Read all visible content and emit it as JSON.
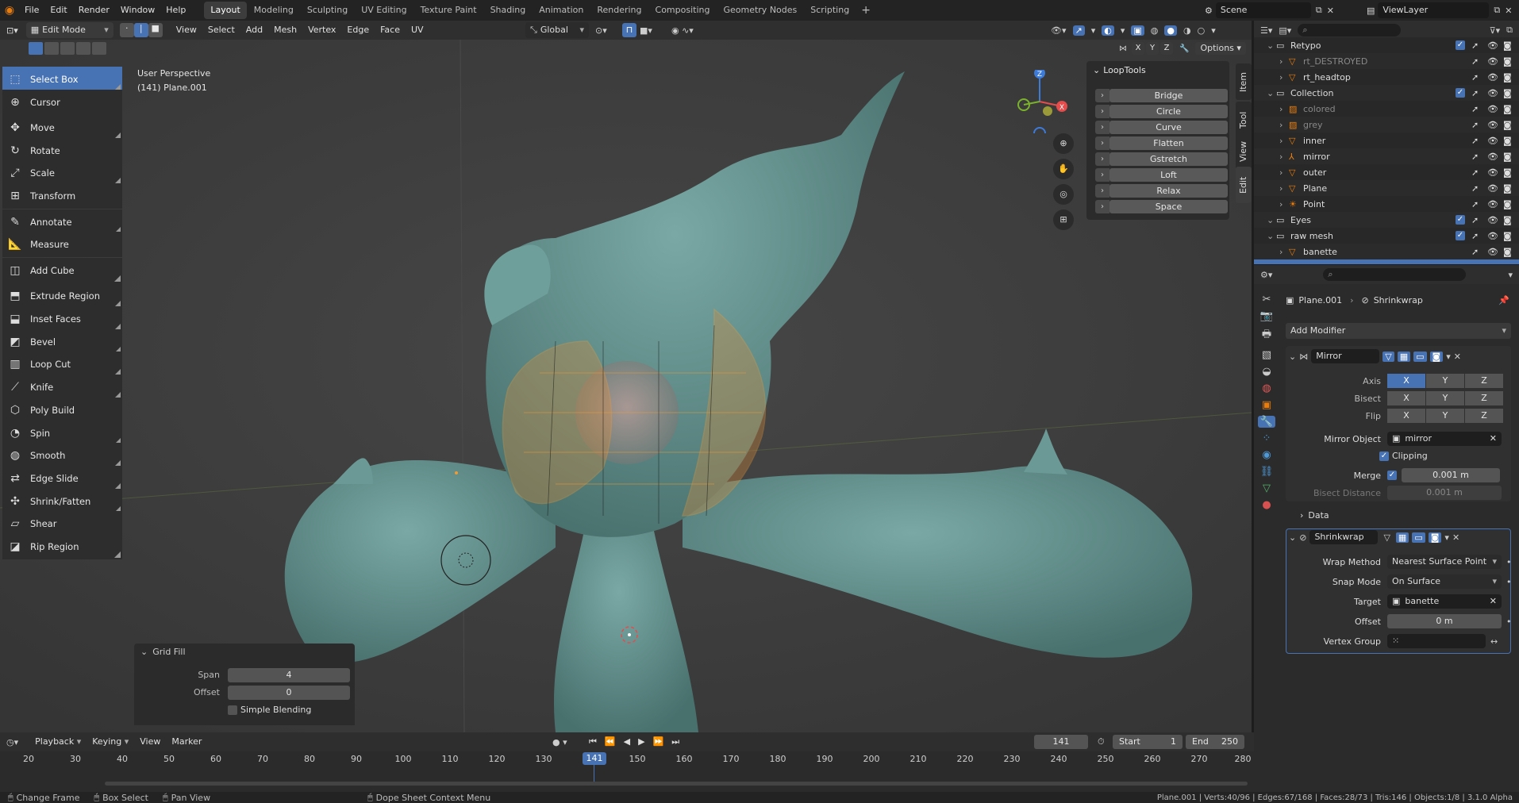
{
  "menu": [
    "File",
    "Edit",
    "Render",
    "Window",
    "Help"
  ],
  "workspaces": [
    "Layout",
    "Modeling",
    "Sculpting",
    "UV Editing",
    "Texture Paint",
    "Shading",
    "Animation",
    "Rendering",
    "Compositing",
    "Geometry Nodes",
    "Scripting"
  ],
  "active_workspace": "Layout",
  "scene": "Scene",
  "view_layer": "ViewLayer",
  "vp_header": {
    "mode": "Edit Mode",
    "menus": [
      "View",
      "Select",
      "Add",
      "Mesh",
      "Vertex",
      "Edge",
      "Face",
      "UV"
    ],
    "orientation": "Global",
    "axes": [
      "X",
      "Y",
      "Z"
    ],
    "options": "Options"
  },
  "viewport": {
    "line1": "User Perspective",
    "line2": "(141) Plane.001"
  },
  "tools": [
    {
      "label": "Select Box",
      "icon": "select-box-icon",
      "active": true
    },
    {
      "label": "Cursor",
      "icon": "cursor-icon"
    },
    {
      "label": "Move",
      "icon": "move-icon"
    },
    {
      "label": "Rotate",
      "icon": "rotate-icon"
    },
    {
      "label": "Scale",
      "icon": "scale-icon"
    },
    {
      "label": "Transform",
      "icon": "transform-icon"
    },
    {
      "label": "Annotate",
      "icon": "annotate-icon"
    },
    {
      "label": "Measure",
      "icon": "measure-icon"
    },
    {
      "label": "Add Cube",
      "icon": "add-cube-icon"
    },
    {
      "label": "Extrude Region",
      "icon": "extrude-icon"
    },
    {
      "label": "Inset Faces",
      "icon": "inset-icon"
    },
    {
      "label": "Bevel",
      "icon": "bevel-icon"
    },
    {
      "label": "Loop Cut",
      "icon": "loop-cut-icon"
    },
    {
      "label": "Knife",
      "icon": "knife-icon"
    },
    {
      "label": "Poly Build",
      "icon": "poly-build-icon"
    },
    {
      "label": "Spin",
      "icon": "spin-icon"
    },
    {
      "label": "Smooth",
      "icon": "smooth-icon"
    },
    {
      "label": "Edge Slide",
      "icon": "edge-slide-icon"
    },
    {
      "label": "Shrink/Fatten",
      "icon": "shrink-fatten-icon"
    },
    {
      "label": "Shear",
      "icon": "shear-icon"
    },
    {
      "label": "Rip Region",
      "icon": "rip-icon"
    }
  ],
  "looptools": {
    "title": "LoopTools",
    "buttons": [
      "Bridge",
      "Circle",
      "Curve",
      "Flatten",
      "Gstretch",
      "Loft",
      "Relax",
      "Space"
    ]
  },
  "side_tabs": [
    "Item",
    "Tool",
    "View",
    "Edit"
  ],
  "gridfill": {
    "title": "Grid Fill",
    "span_label": "Span",
    "span": "4",
    "offset_label": "Offset",
    "offset": "0",
    "blend_label": "Simple Blending"
  },
  "outliner": [
    {
      "name": "Retypo",
      "kind": "collection",
      "indent": 0,
      "check": true
    },
    {
      "name": "rt_DESTROYED",
      "kind": "mesh",
      "indent": 1,
      "dim": true
    },
    {
      "name": "rt_headtop",
      "kind": "mesh",
      "indent": 1
    },
    {
      "name": "Collection",
      "kind": "collection",
      "indent": 0,
      "check": true
    },
    {
      "name": "colored",
      "kind": "image",
      "indent": 1,
      "dim": true
    },
    {
      "name": "grey",
      "kind": "image",
      "indent": 1,
      "dim": true
    },
    {
      "name": "inner",
      "kind": "mesh",
      "indent": 1
    },
    {
      "name": "mirror",
      "kind": "empty",
      "indent": 1
    },
    {
      "name": "outer",
      "kind": "mesh",
      "indent": 1
    },
    {
      "name": "Plane",
      "kind": "mesh",
      "indent": 1
    },
    {
      "name": "Point",
      "kind": "light",
      "indent": 1
    },
    {
      "name": "Eyes",
      "kind": "collection",
      "indent": 0,
      "check": true
    },
    {
      "name": "raw mesh",
      "kind": "collection",
      "indent": 0,
      "check": true
    },
    {
      "name": "banette",
      "kind": "mesh",
      "indent": 1
    }
  ],
  "props": {
    "object": "Plane.001",
    "modifier_crumb": "Shrinkwrap",
    "add_modifier": "Add Modifier",
    "mirror": {
      "name": "Mirror",
      "axis_label": "Axis",
      "bisect_label": "Bisect",
      "flip_label": "Flip",
      "axes": [
        "X",
        "Y",
        "Z"
      ],
      "mirror_object_label": "Mirror Object",
      "mirror_object": "mirror",
      "clipping_label": "Clipping",
      "merge_label": "Merge",
      "merge": "0.001 m",
      "bisect_distance_label": "Bisect Distance",
      "bisect_distance": "0.001 m",
      "data_label": "Data"
    },
    "shrinkwrap": {
      "name": "Shrinkwrap",
      "wrap_method_label": "Wrap Method",
      "wrap_method": "Nearest Surface Point",
      "snap_mode_label": "Snap Mode",
      "snap_mode": "On Surface",
      "target_label": "Target",
      "target": "banette",
      "offset_label": "Offset",
      "offset": "0 m",
      "vertex_group_label": "Vertex Group"
    }
  },
  "timeline": {
    "menus": [
      "Playback",
      "Keying",
      "View",
      "Marker"
    ],
    "current_frame": "141",
    "start_label": "Start",
    "start": "1",
    "end_label": "End",
    "end": "250",
    "ticks": [
      "20",
      "30",
      "40",
      "50",
      "60",
      "70",
      "80",
      "90",
      "100",
      "110",
      "120",
      "130",
      "141",
      "150",
      "160",
      "170",
      "180",
      "190",
      "200",
      "210",
      "220",
      "230",
      "240",
      "250",
      "260",
      "270",
      "280"
    ]
  },
  "status": {
    "items": [
      "Change Frame",
      "Box Select",
      "Pan View",
      "Dope Sheet Context Menu"
    ],
    "stats": "Plane.001 | Verts:40/96 | Edges:67/168 | Faces:28/73 | Tris:146 | Objects:1/8 | 3.1.0 Alpha"
  },
  "colors": {
    "accent": "#4772b3",
    "selection": "#f29b33",
    "mesh": "#5d8f8c"
  }
}
